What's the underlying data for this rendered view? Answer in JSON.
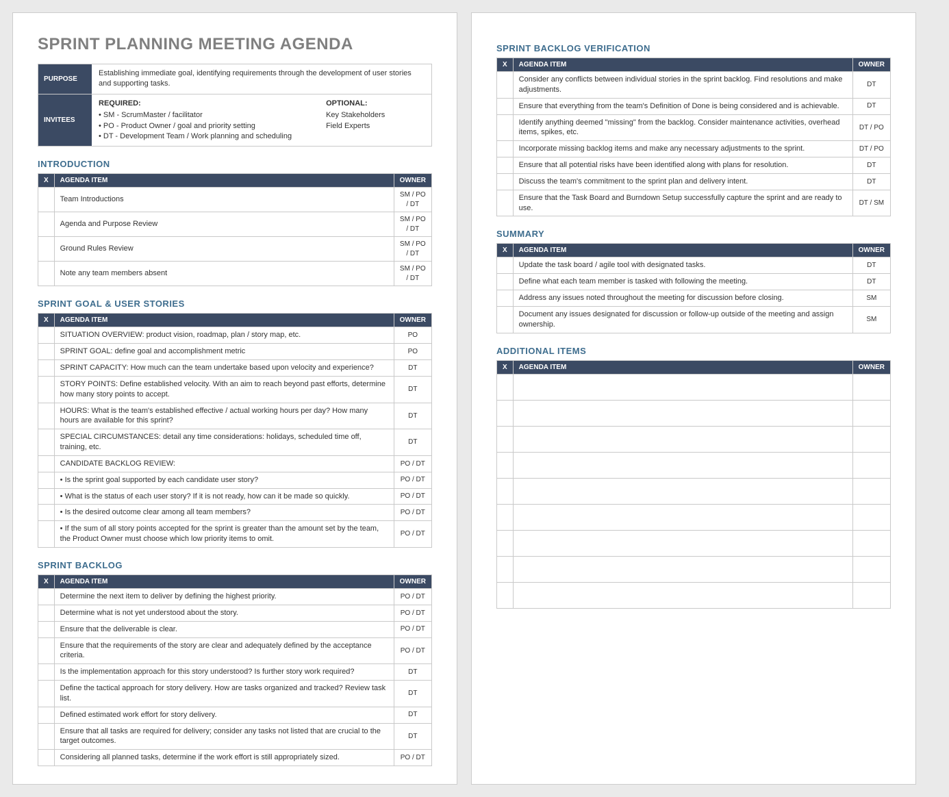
{
  "docTitle": "SPRINT PLANNING MEETING AGENDA",
  "info": {
    "purposeLabel": "PURPOSE",
    "purposeText": "Establishing immediate goal, identifying requirements through the development of user stories and supporting tasks.",
    "inviteesLabel": "INVITEES",
    "requiredLabel": "REQUIRED:",
    "requiredLines": [
      "• SM - ScrumMaster / facilitator",
      "• PO - Product Owner / goal and priority setting",
      "• DT - Development Team / Work planning and scheduling"
    ],
    "optionalLabel": "OPTIONAL:",
    "optionalLines": [
      "Key Stakeholders",
      "Field Experts"
    ]
  },
  "cols": {
    "x": "X",
    "item": "AGENDA ITEM",
    "owner": "OWNER"
  },
  "sections": {
    "intro": {
      "title": "INTRODUCTION",
      "rows": [
        {
          "item": "Team Introductions",
          "owner": "SM / PO / DT"
        },
        {
          "item": "Agenda and Purpose Review",
          "owner": "SM / PO / DT"
        },
        {
          "item": "Ground Rules Review",
          "owner": "SM / PO / DT"
        },
        {
          "item": "Note any team members absent",
          "owner": "SM / PO / DT"
        }
      ]
    },
    "goal": {
      "title": "SPRINT GOAL & USER STORIES",
      "rows": [
        {
          "item": "SITUATION OVERVIEW: product vision, roadmap, plan / story map, etc.",
          "owner": "PO"
        },
        {
          "item": "SPRINT GOAL: define goal and accomplishment metric",
          "owner": "PO"
        },
        {
          "item": "SPRINT CAPACITY: How much can the team undertake based upon velocity and experience?",
          "owner": "DT"
        },
        {
          "item": "STORY POINTS: Define established velocity. With an aim to reach beyond past efforts, determine how many story points to accept.",
          "owner": "DT"
        },
        {
          "item": "HOURS: What is the team's established effective / actual working hours per day? How many hours are available for this sprint?",
          "owner": "DT"
        },
        {
          "item": "SPECIAL CIRCUMSTANCES: detail any time considerations: holidays, scheduled time off, training, etc.",
          "owner": "DT"
        },
        {
          "item": "CANDIDATE BACKLOG REVIEW:",
          "owner": "PO / DT"
        },
        {
          "item": "• Is the sprint goal supported by each candidate user story?",
          "owner": "PO / DT"
        },
        {
          "item": "• What is the status of each user story? If it is not ready, how can it be made so quickly.",
          "owner": "PO / DT"
        },
        {
          "item": "• Is the desired outcome clear among all team members?",
          "owner": "PO / DT"
        },
        {
          "item": "• If the sum of all story points accepted for the sprint is greater than the amount set by the team, the Product Owner must choose which low priority items to omit.",
          "owner": "PO / DT"
        }
      ]
    },
    "backlog": {
      "title": "SPRINT BACKLOG",
      "rows": [
        {
          "item": "Determine the next item to deliver by defining the highest priority.",
          "owner": "PO / DT"
        },
        {
          "item": "Determine what is not yet understood about the story.",
          "owner": "PO / DT"
        },
        {
          "item": "Ensure that the deliverable is clear.",
          "owner": "PO / DT"
        },
        {
          "item": "Ensure that the requirements of the story are clear and adequately defined by the acceptance criteria.",
          "owner": "PO / DT"
        },
        {
          "item": "Is the implementation approach for this story understood?  Is further story work required?",
          "owner": "DT"
        },
        {
          "item": "Define the tactical approach for story delivery.  How are tasks organized and tracked? Review task list.",
          "owner": "DT"
        },
        {
          "item": "Defined estimated work effort for story delivery.",
          "owner": "DT"
        },
        {
          "item": "Ensure that all tasks are required for delivery; consider any tasks not listed that are crucial to the target outcomes.",
          "owner": "DT"
        },
        {
          "item": "Considering all planned tasks, determine if the work effort is still appropriately sized.",
          "owner": "PO / DT"
        }
      ]
    },
    "verify": {
      "title": "SPRINT BACKLOG VERIFICATION",
      "rows": [
        {
          "item": "Consider any conflicts between individual stories in the sprint backlog. Find resolutions and make adjustments.",
          "owner": "DT"
        },
        {
          "item": "Ensure that everything from the team's Definition of Done is being considered and is achievable.",
          "owner": "DT"
        },
        {
          "item": "Identify anything deemed \"missing\" from the backlog. Consider maintenance activities, overhead items, spikes, etc.",
          "owner": "DT / PO"
        },
        {
          "item": "Incorporate missing backlog items and make any necessary adjustments to the sprint.",
          "owner": "DT / PO"
        },
        {
          "item": "Ensure that all potential risks have been identified along with plans for resolution.",
          "owner": "DT"
        },
        {
          "item": "Discuss the team's commitment to the sprint plan and delivery intent.",
          "owner": "DT"
        },
        {
          "item": "Ensure that the Task Board and Burndown Setup successfully capture the sprint and are ready to use.",
          "owner": "DT / SM"
        }
      ]
    },
    "summary": {
      "title": "SUMMARY",
      "rows": [
        {
          "item": "Update the task board / agile tool with designated tasks.",
          "owner": "DT"
        },
        {
          "item": "Define what each team member is tasked with following the meeting.",
          "owner": "DT"
        },
        {
          "item": "Address any issues noted throughout the meeting for discussion before closing.",
          "owner": "SM"
        },
        {
          "item": "Document any issues designated for discussion or follow-up outside of the meeting and assign ownership.",
          "owner": "SM"
        }
      ]
    },
    "additional": {
      "title": "ADDITIONAL ITEMS",
      "rows": [
        {
          "item": "",
          "owner": ""
        },
        {
          "item": "",
          "owner": ""
        },
        {
          "item": "",
          "owner": ""
        },
        {
          "item": "",
          "owner": ""
        },
        {
          "item": "",
          "owner": ""
        },
        {
          "item": "",
          "owner": ""
        },
        {
          "item": "",
          "owner": ""
        },
        {
          "item": "",
          "owner": ""
        },
        {
          "item": "",
          "owner": ""
        }
      ]
    }
  }
}
